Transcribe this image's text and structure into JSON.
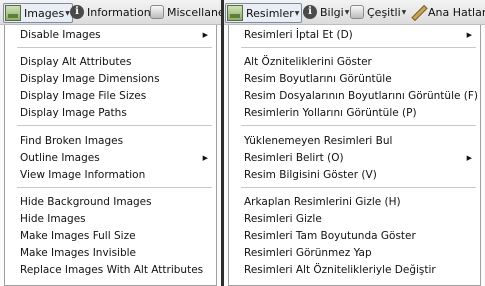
{
  "left": {
    "toolbar": [
      {
        "label": "Images",
        "icon": "images-icon"
      },
      {
        "label": "Information",
        "icon": "info-icon"
      },
      {
        "label": "Miscellaneous",
        "icon": "misc-icon"
      }
    ],
    "menu": [
      {
        "label": "Disable Images",
        "submenu": true
      },
      {
        "label": "Display Alt Attributes"
      },
      {
        "label": "Display Image Dimensions"
      },
      {
        "label": "Display Image File Sizes"
      },
      {
        "label": "Display Image Paths"
      },
      {
        "label": "Find Broken Images"
      },
      {
        "label": "Outline Images",
        "submenu": true
      },
      {
        "label": "View Image Information"
      },
      {
        "label": "Hide Background Images"
      },
      {
        "label": "Hide Images"
      },
      {
        "label": "Make Images Full Size"
      },
      {
        "label": "Make Images Invisible"
      },
      {
        "label": "Replace Images With Alt Attributes"
      }
    ]
  },
  "right": {
    "toolbar": [
      {
        "label": "Resimler",
        "icon": "images-icon"
      },
      {
        "label": "Bilgi",
        "icon": "info-icon"
      },
      {
        "label": "Çeşitli",
        "icon": "misc-icon"
      },
      {
        "label": "Ana Hatlar",
        "icon": "pen-icon"
      }
    ],
    "menu": [
      {
        "label": "Resimleri İptal Et (D)",
        "submenu": true
      },
      {
        "label": "Alt Özniteliklerini Göster"
      },
      {
        "label": "Resim Boyutlarını Görüntüle"
      },
      {
        "label": "Resim Dosyalarının Boyutlarını Görüntüle (F)"
      },
      {
        "label": "Resimlerin Yollarını Görüntüle (P)"
      },
      {
        "label": "Yüklenemeyen Resimleri Bul"
      },
      {
        "label": "Resimleri Belirt (O)",
        "submenu": true
      },
      {
        "label": "Resim Bilgisini Göster (V)"
      },
      {
        "label": "Arkaplan Resimlerini Gizle (H)"
      },
      {
        "label": "Resimleri Gizle"
      },
      {
        "label": "Resimleri Tam Boyutunda Göster"
      },
      {
        "label": "Resimleri Görünmez Yap"
      },
      {
        "label": "Resimleri Alt Öznitelikleriyle Değiştir"
      }
    ]
  },
  "submenu_arrow": "▶",
  "dropdown_arrow": "▼"
}
